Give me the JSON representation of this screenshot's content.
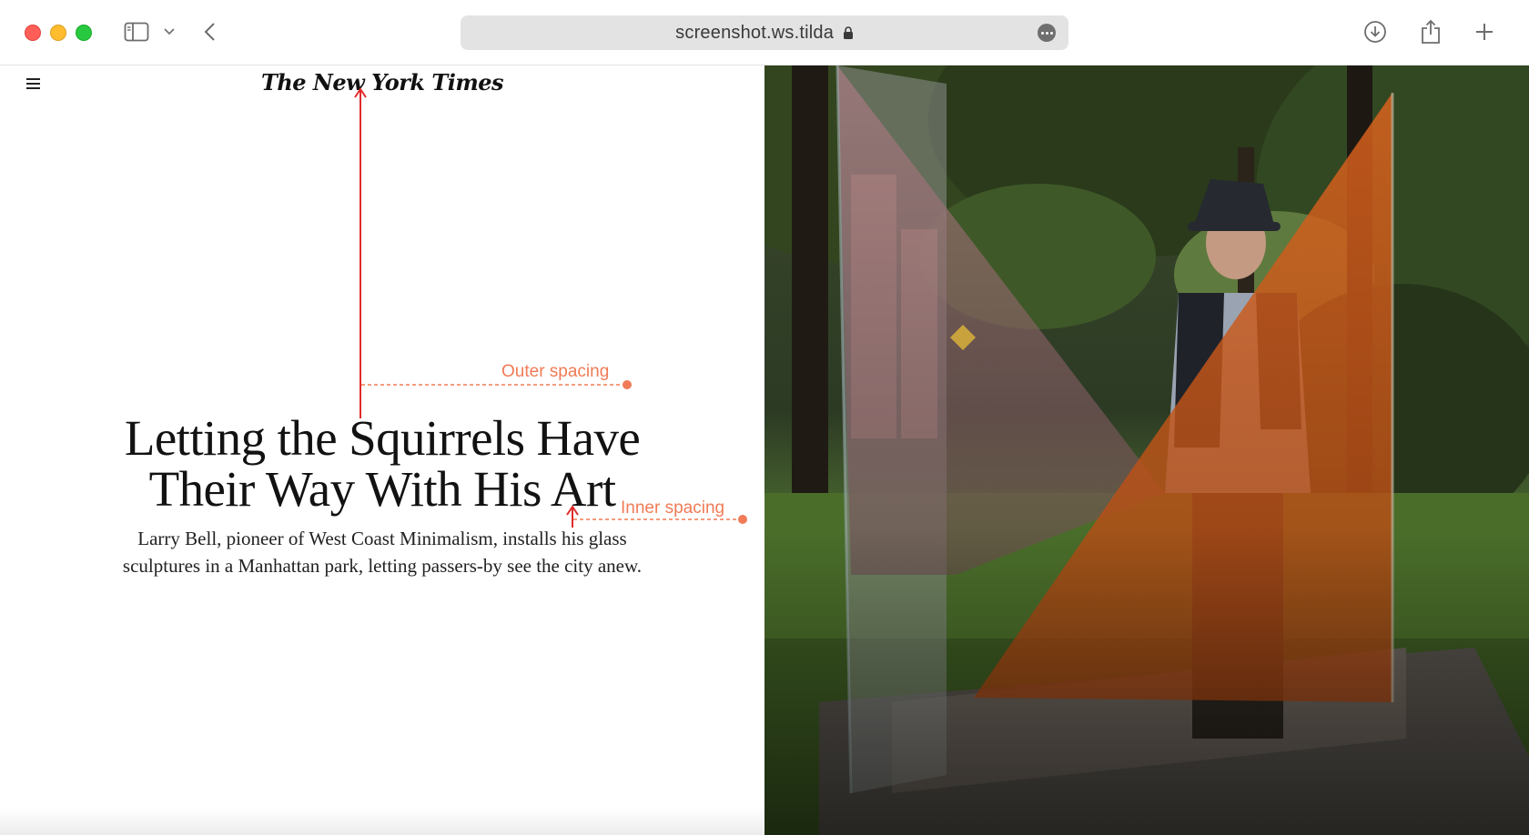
{
  "browser": {
    "url": "screenshot.ws.tilda",
    "toolbar_icons": [
      "sidebar-icon",
      "chevron-down-icon",
      "back-icon",
      "lock-icon",
      "more-icon",
      "download-icon",
      "share-icon",
      "new-tab-icon"
    ]
  },
  "article": {
    "masthead": "The New York Times",
    "headline_line1": "Letting the Squirrels Have",
    "headline_line2": "Their Way With His Art",
    "summary": "Larry Bell, pioneer of West Coast Minimalism, installs his glass sculptures in a Manhattan park, letting passers-by see the city anew."
  },
  "annotations": {
    "outer": "Outer spacing",
    "inner": "Inner spacing",
    "color": "#f07b56",
    "arrow_color": "#e02a2a"
  }
}
